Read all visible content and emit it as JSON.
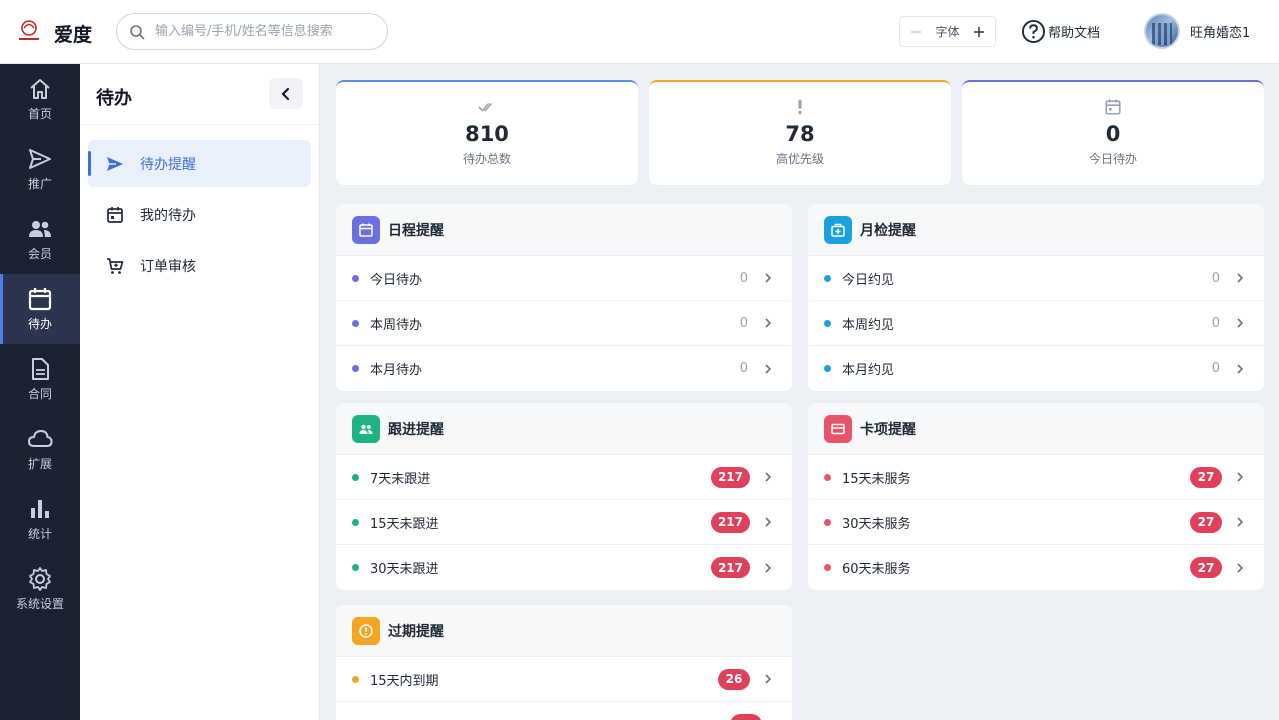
{
  "header": {
    "brand": "爱度",
    "search_placeholder": "输入编号/手机/姓名等信息搜索",
    "font_label": "字体",
    "help_label": "帮助文档",
    "user_name": "旺角婚恋1"
  },
  "nav": [
    {
      "label": "首页",
      "icon": "home-icon"
    },
    {
      "label": "推广",
      "icon": "send-icon"
    },
    {
      "label": "会员",
      "icon": "users-icon"
    },
    {
      "label": "待办",
      "icon": "calendar-icon",
      "active": true
    },
    {
      "label": "合同",
      "icon": "document-icon"
    },
    {
      "label": "扩展",
      "icon": "cloud-icon"
    },
    {
      "label": "统计",
      "icon": "bar-chart-icon"
    },
    {
      "label": "系统设置",
      "icon": "gear-icon"
    }
  ],
  "subnav": {
    "title": "待办",
    "items": [
      {
        "label": "待办提醒",
        "active": true
      },
      {
        "label": "我的待办"
      },
      {
        "label": "订单审核"
      }
    ]
  },
  "stats": [
    {
      "value": "810",
      "label": "待办总数",
      "color": "#5b8def"
    },
    {
      "value": "78",
      "label": "高优先级",
      "color": "#f5a524"
    },
    {
      "value": "0",
      "label": "今日待办",
      "color": "#6b6fe0"
    }
  ],
  "cards": {
    "schedule": {
      "title": "日程提醒",
      "color": "#6b6fe0",
      "rows": [
        {
          "label": "今日待办",
          "count": "0"
        },
        {
          "label": "本周待办",
          "count": "0"
        },
        {
          "label": "本月待办",
          "count": "0"
        }
      ]
    },
    "monthly": {
      "title": "月检提醒",
      "color": "#1aa2e0",
      "rows": [
        {
          "label": "今日约见",
          "count": "0"
        },
        {
          "label": "本周约见",
          "count": "0"
        },
        {
          "label": "本月约见",
          "count": "0"
        }
      ]
    },
    "followup": {
      "title": "跟进提醒",
      "color": "#1fb37f",
      "rows": [
        {
          "label": "7天未跟进",
          "count": "217"
        },
        {
          "label": "15天未跟进",
          "count": "217"
        },
        {
          "label": "30天未跟进",
          "count": "217"
        }
      ]
    },
    "card_item": {
      "title": "卡项提醒",
      "color": "#e8556a",
      "rows": [
        {
          "label": "15天未服务",
          "count": "27"
        },
        {
          "label": "30天未服务",
          "count": "27"
        },
        {
          "label": "60天未服务",
          "count": "27"
        }
      ]
    },
    "expire": {
      "title": "过期提醒",
      "color": "#f5a524",
      "rows": [
        {
          "label": "15天内到期",
          "count": "26"
        }
      ]
    }
  }
}
